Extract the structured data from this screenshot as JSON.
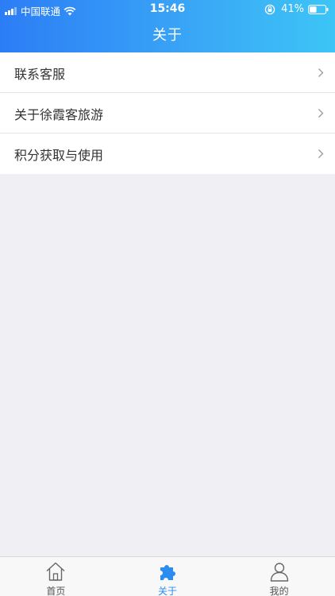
{
  "status_bar": {
    "carrier": "中国联通",
    "time": "15:46",
    "battery": "41%"
  },
  "header": {
    "title": "关于"
  },
  "menu": {
    "items": [
      {
        "label": "联系客服"
      },
      {
        "label": "关于徐霞客旅游"
      },
      {
        "label": "积分获取与使用"
      }
    ]
  },
  "tabbar": {
    "tabs": [
      {
        "label": "首页",
        "icon": "home-icon"
      },
      {
        "label": "关于",
        "icon": "puzzle-icon"
      },
      {
        "label": "我的",
        "icon": "user-icon"
      }
    ],
    "active_color": "#2d8cf0"
  },
  "colors": {
    "header_start": "#2c7df5",
    "header_end": "#3cc5f6",
    "background": "#efeff4"
  }
}
